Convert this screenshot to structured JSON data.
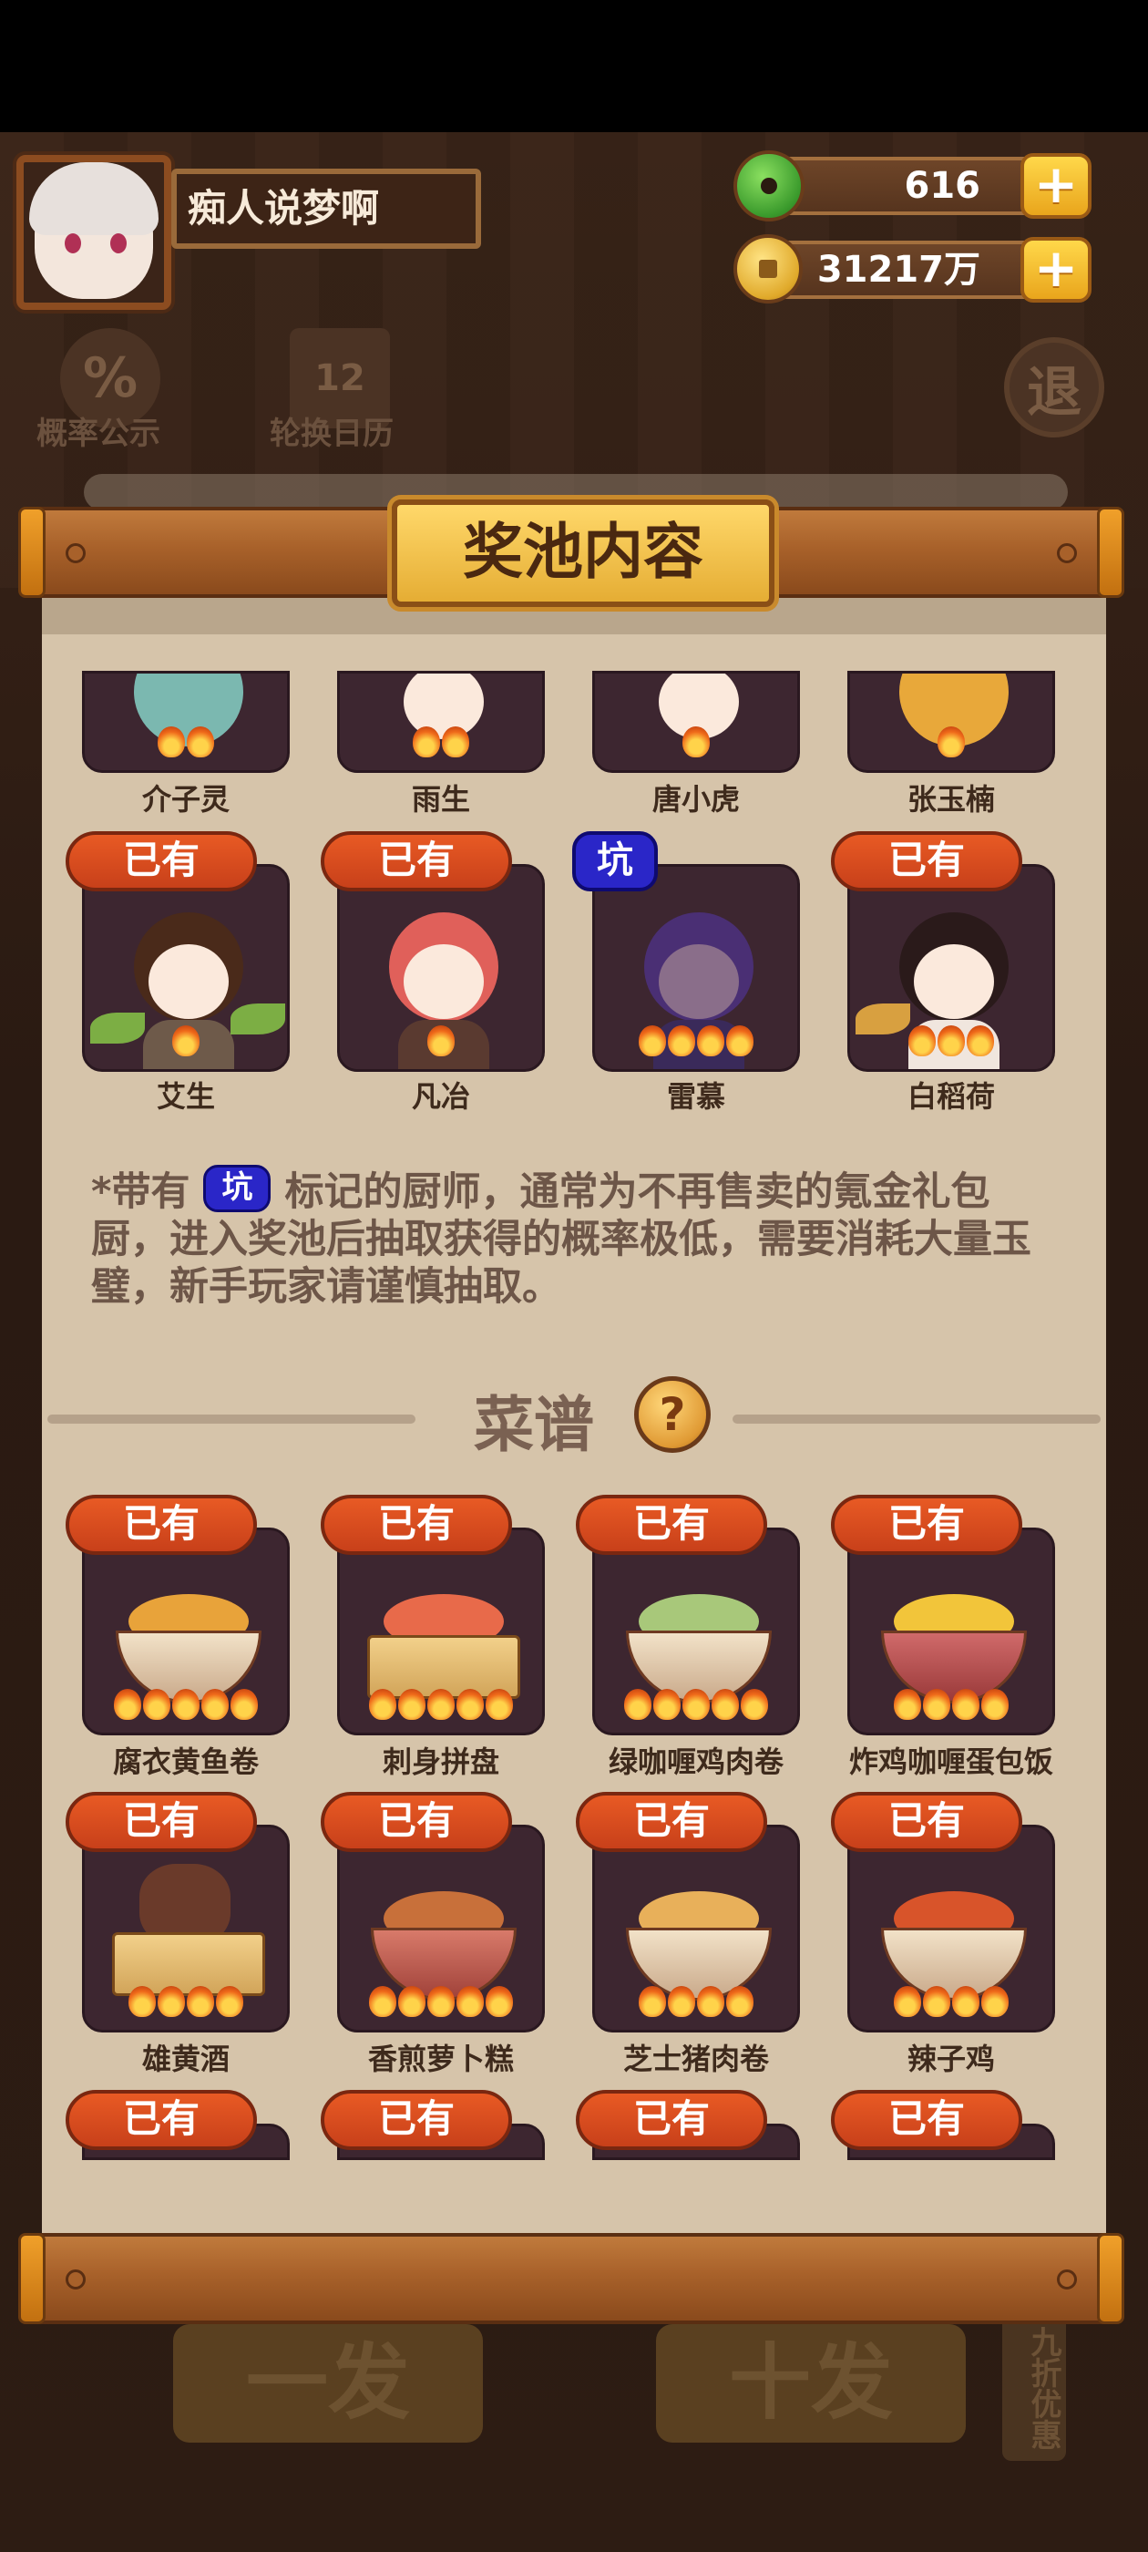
{
  "header": {
    "player_name": "痴人说梦啊",
    "jade_amount": "616",
    "coin_amount": "31217万",
    "plus_label": "+"
  },
  "background": {
    "prob_icon": "%",
    "prob_label": "概率公示",
    "calendar_icon": "12",
    "calendar_label": "轮换日历",
    "exit_label": "退",
    "button_one": "一发",
    "button_ten": "十发",
    "side_discount": "九折优惠"
  },
  "modal": {
    "title": "奖池内容",
    "characters_top_row": [
      "介子灵",
      "雨生",
      "唐小虎",
      "张玉楠"
    ],
    "characters": [
      {
        "name": "艾生",
        "tag": "已有"
      },
      {
        "name": "凡冶",
        "tag": "已有"
      },
      {
        "name": "雷慕",
        "tag": "坑"
      },
      {
        "name": "白稻荷",
        "tag": "已有"
      }
    ],
    "note_prefix": "*带有",
    "note_tag": "坑",
    "note_text": "标记的厨师，通常为不再售卖的氪金礼包厨，进入奖池后抽取获得的概率极低，需要消耗大量玉璧，新手玩家请谨慎抽取。",
    "recipes_title": "菜谱",
    "help_icon": "?",
    "recipes_row1": [
      {
        "name": "腐衣黄鱼卷",
        "tag": "已有"
      },
      {
        "name": "刺身拼盘",
        "tag": "已有"
      },
      {
        "name": "绿咖喱鸡肉卷",
        "tag": "已有"
      },
      {
        "name": "炸鸡咖喱蛋包饭",
        "tag": "已有"
      }
    ],
    "recipes_row2": [
      {
        "name": "雄黄酒",
        "tag": "已有"
      },
      {
        "name": "香煎萝卜糕",
        "tag": "已有"
      },
      {
        "name": "芝士猪肉卷",
        "tag": "已有"
      },
      {
        "name": "辣子鸡",
        "tag": "已有"
      }
    ],
    "recipes_row3_tags": [
      "已有",
      "已有",
      "已有",
      "已有"
    ]
  },
  "colors": {
    "tag_have": "#d94a1e",
    "tag_pit": "#2a26c8",
    "paper": "#d6c4aa",
    "card": "#3d2630"
  }
}
